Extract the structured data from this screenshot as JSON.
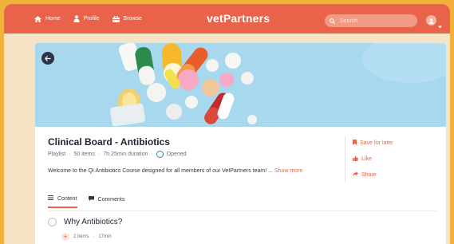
{
  "nav": {
    "home_label": "Home",
    "profile_label": "Profile",
    "browse_label": "Browse"
  },
  "brand": {
    "logo_text": "vetPartners"
  },
  "search": {
    "placeholder": "Search",
    "value": ""
  },
  "course": {
    "title": "Clinical Board - Antibiotics",
    "type": "Playlist",
    "items": "50 items",
    "duration": "7h 25min duration",
    "status": "Opened",
    "description": "Welcome to the QI Antibiotics Course designed for all members of our VetPartners team! ...",
    "show_more": "Show more"
  },
  "actions": {
    "save": "Save for later",
    "like": "Like",
    "share": "Share"
  },
  "tabs": [
    {
      "label": "Content",
      "active": true
    },
    {
      "label": "Comments",
      "active": false
    }
  ],
  "lessons": [
    {
      "title": "Why Antibiotics?",
      "items": "2 items",
      "duration": "17min"
    }
  ],
  "colors": {
    "brand": "#e9634a",
    "background": "#f0b23c",
    "hero": "#a8d8ee"
  },
  "icons": [
    "home-icon",
    "profile-icon",
    "browse-icon",
    "search-icon",
    "user-icon",
    "chevron-down-icon",
    "back-arrow-icon",
    "bookmark-icon",
    "thumbs-up-icon",
    "share-icon",
    "list-icon",
    "comment-icon",
    "plus-icon"
  ]
}
